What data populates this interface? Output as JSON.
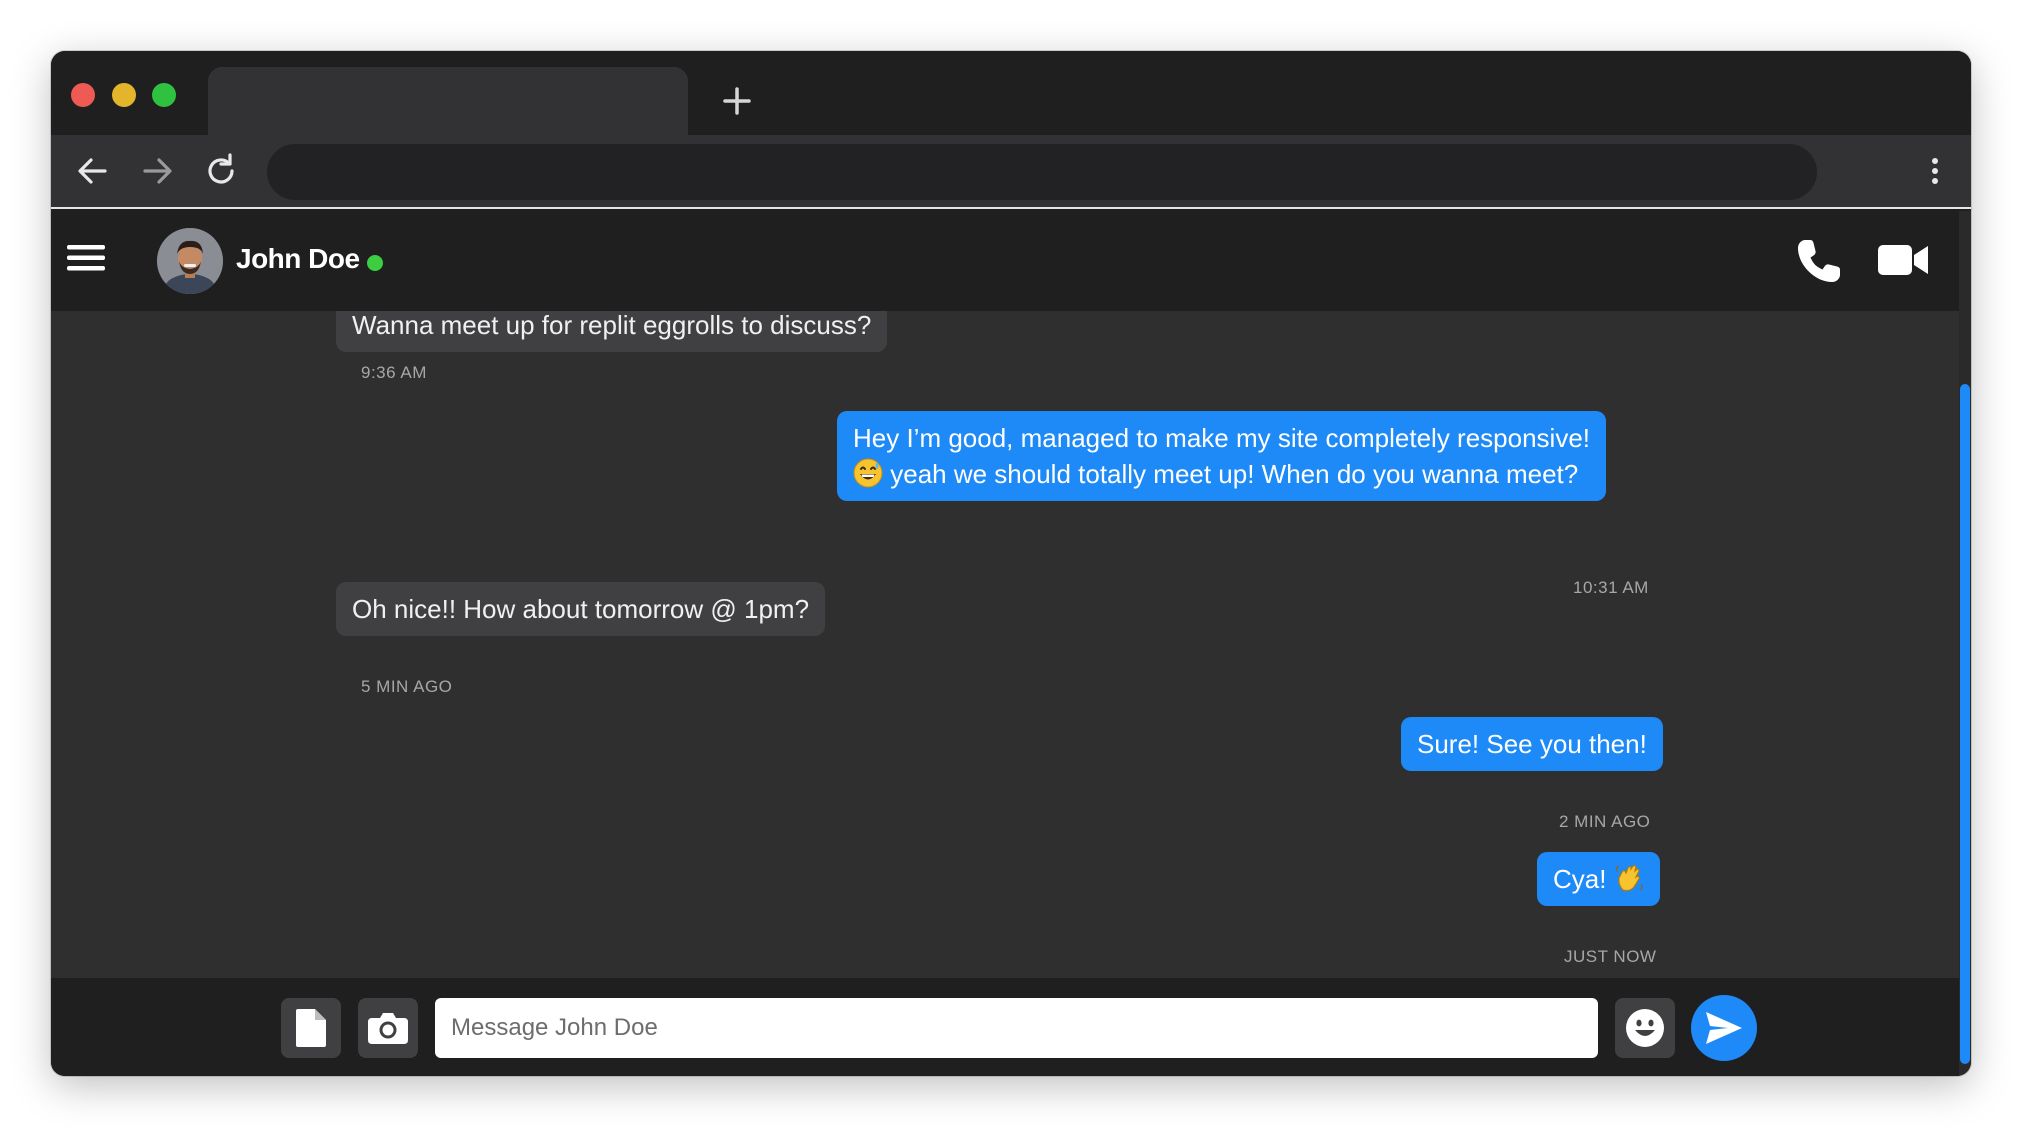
{
  "browser": {
    "traffic_lights": [
      "#ee5b54",
      "#e4b52a",
      "#2fc241"
    ],
    "new_tab_icon": "plus-icon",
    "back_icon": "arrow-left-icon",
    "forward_icon": "arrow-right-icon",
    "reload_icon": "reload-icon",
    "menu_icon": "kebab-icon",
    "url": ""
  },
  "header": {
    "contact_name": "John Doe",
    "status_color": "#3ccd40",
    "menu_icon": "hamburger-icon",
    "call_icon": "phone-icon",
    "video_icon": "video-camera-icon"
  },
  "messages": [
    {
      "direction": "incoming",
      "text": "Wanna meet up for replit eggrolls to discuss?",
      "time": "9:36 AM"
    },
    {
      "direction": "outgoing",
      "line1": "Hey I’m good, managed to make my site completely responsive!",
      "line2": "yeah we should totally meet up! When do you wanna meet?",
      "emoji": "grinning-sweat-emoji",
      "time": "10:31 AM"
    },
    {
      "direction": "incoming",
      "text": "Oh nice!! How about tomorrow @ 1pm?",
      "time": "5 MIN AGO"
    },
    {
      "direction": "outgoing",
      "text": "Sure! See you then!",
      "time": "2 MIN AGO"
    },
    {
      "direction": "outgoing",
      "text": "Cya!",
      "emoji": "waving-hand-emoji",
      "time": "JUST NOW"
    }
  ],
  "composer": {
    "placeholder": "Message John Doe",
    "file_icon": "file-icon",
    "camera_icon": "camera-icon",
    "emoji_icon": "smiley-icon",
    "send_icon": "send-icon"
  },
  "colors": {
    "accent": "#1e8af8",
    "incoming_bubble": "#404042",
    "background": "#2f2f30"
  }
}
